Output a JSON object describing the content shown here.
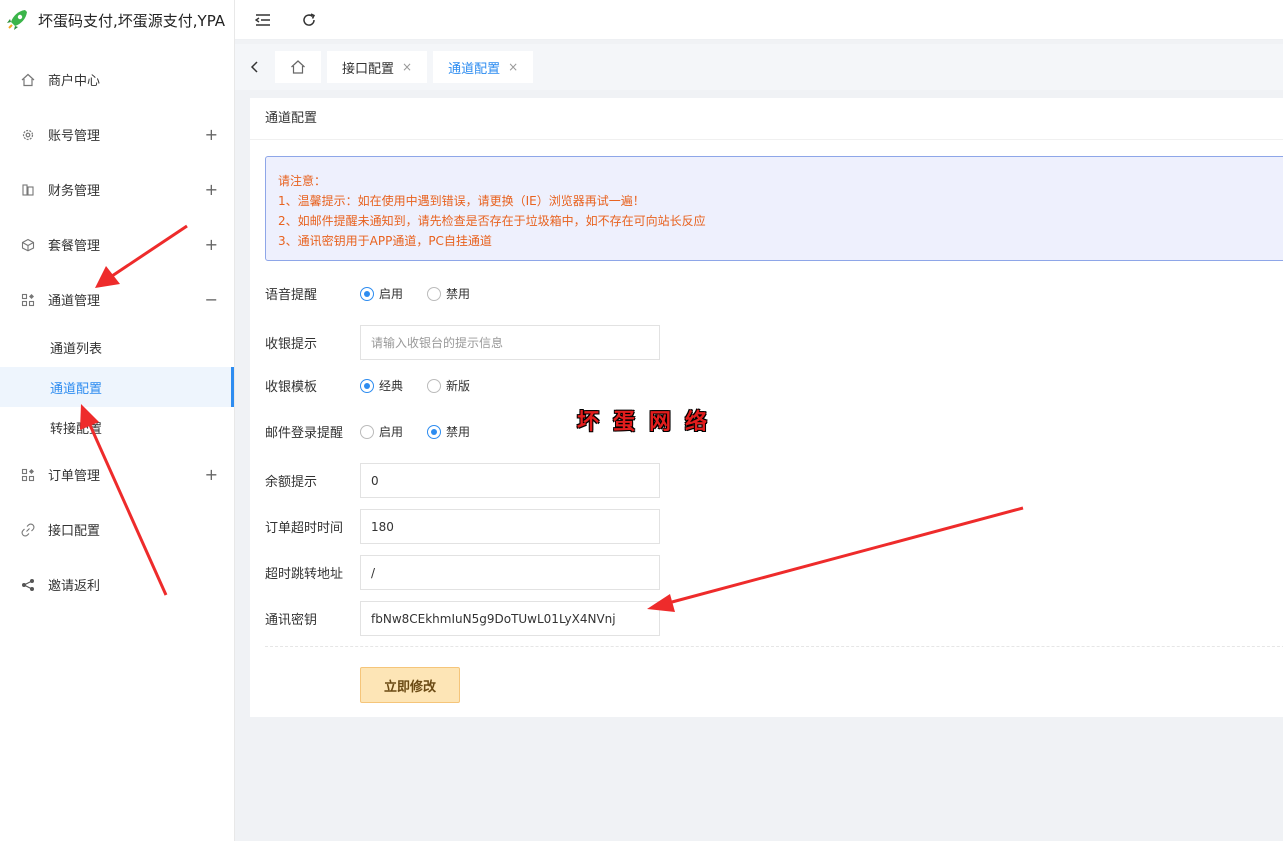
{
  "brand": {
    "title": "坏蛋码支付,坏蛋源支付,YPA"
  },
  "sidebar": {
    "items": [
      {
        "label": "商户中心",
        "icon": "home-icon"
      },
      {
        "label": "账号管理",
        "icon": "gear-icon",
        "toggle": "+"
      },
      {
        "label": "财务管理",
        "icon": "ledger-icon",
        "toggle": "+"
      },
      {
        "label": "套餐管理",
        "icon": "cube-icon",
        "toggle": "+"
      },
      {
        "label": "通道管理",
        "icon": "apps-icon",
        "toggle": "−"
      },
      {
        "label": "订单管理",
        "icon": "apps-icon",
        "toggle": "+"
      },
      {
        "label": "接口配置",
        "icon": "link-icon"
      },
      {
        "label": "邀请返利",
        "icon": "share-icon"
      }
    ],
    "submenu": [
      "通道列表",
      "通道配置",
      "转接配置"
    ]
  },
  "tabs": [
    {
      "label": "接口配置",
      "close": "×"
    },
    {
      "label": "通道配置",
      "close": "×"
    }
  ],
  "card": {
    "title": "通道配置",
    "notice": [
      "请注意：",
      "1、温馨提示：如在使用中遇到错误，请更换（IE）浏览器再试一遍！",
      "2、如邮件提醒未通知到，请先检查是否存在于垃圾箱中，如不存在可向站长反应",
      "3、通讯密钥用于APP通道，PC自挂通道"
    ],
    "form": {
      "voice_label": "语音提醒",
      "voice_on": "启用",
      "voice_off": "禁用",
      "cashier_tip_label": "收银提示",
      "cashier_tip_placeholder": "请输入收银台的提示信息",
      "template_label": "收银模板",
      "template_classic": "经典",
      "template_new": "新版",
      "mail_label": "邮件登录提醒",
      "mail_on": "启用",
      "mail_off": "禁用",
      "balance_label": "余额提示",
      "balance_value": "0",
      "timeout_label": "订单超时时间",
      "timeout_value": "180",
      "redirect_label": "超时跳转地址",
      "redirect_value": "/",
      "key_label": "通讯密钥",
      "key_value": "fbNw8CEkhmIuN5g9DoTUwL01LyX4NVnj",
      "submit": "立即修改"
    }
  },
  "watermark": "坏蛋网络",
  "colors": {
    "accent": "#2d8cf0",
    "notice_text": "#e8621f",
    "arrow": "#ee2b2b"
  }
}
